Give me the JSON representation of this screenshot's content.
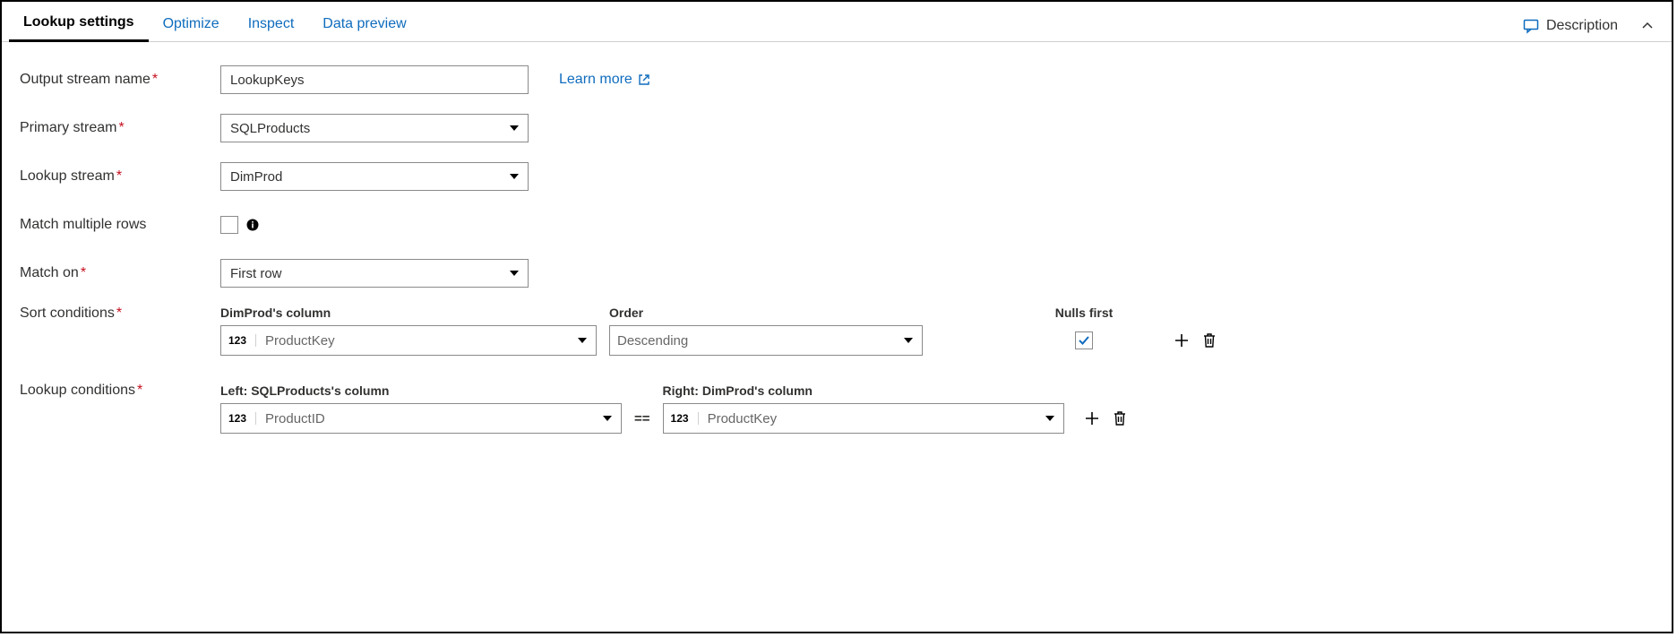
{
  "tabs": {
    "items": [
      "Lookup settings",
      "Optimize",
      "Inspect",
      "Data preview"
    ],
    "active_index": 0
  },
  "header": {
    "description_label": "Description"
  },
  "form": {
    "output_stream_label": "Output stream name",
    "output_stream_value": "LookupKeys",
    "learn_more_label": "Learn more",
    "primary_stream_label": "Primary stream",
    "primary_stream_value": "SQLProducts",
    "lookup_stream_label": "Lookup stream",
    "lookup_stream_value": "DimProd",
    "match_multiple_label": "Match multiple rows",
    "match_multiple_checked": false,
    "match_on_label": "Match on",
    "match_on_value": "First row",
    "sort_conditions_label": "Sort conditions",
    "sort": {
      "column_header": "DimProd's column",
      "order_header": "Order",
      "nulls_header": "Nulls first",
      "row": {
        "type_badge": "123",
        "column_value": "ProductKey",
        "order_value": "Descending",
        "nulls_first_checked": true
      }
    },
    "lookup_conditions_label": "Lookup conditions",
    "lookup": {
      "left_header": "Left: SQLProducts's column",
      "right_header": "Right: DimProd's column",
      "operator": "==",
      "row": {
        "left_type_badge": "123",
        "left_value": "ProductID",
        "right_type_badge": "123",
        "right_value": "ProductKey"
      }
    }
  }
}
